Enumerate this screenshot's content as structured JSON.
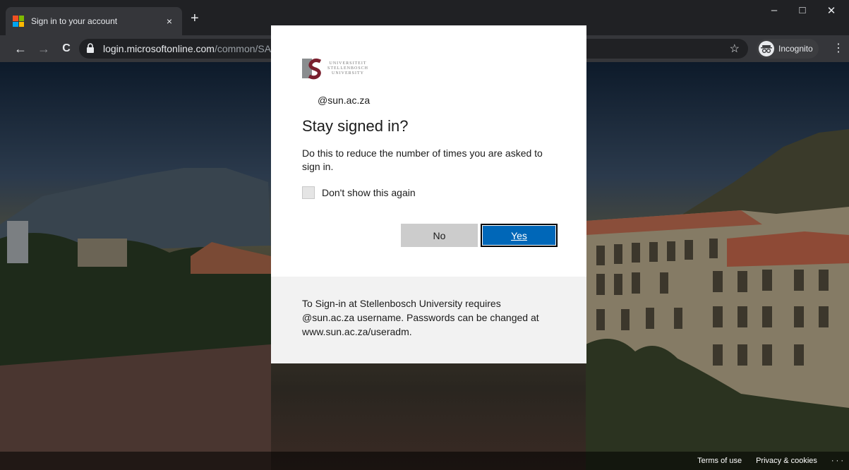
{
  "browser": {
    "tab_title": "Sign in to your account",
    "tab_close": "×",
    "new_tab": "+",
    "window_controls": {
      "minimize": "–",
      "maximize": "□",
      "close": "✕"
    },
    "nav": {
      "back": "←",
      "forward": "→",
      "reload": "C"
    },
    "url_host": "login.microsoftonline.com",
    "url_path": "/common/SAS/ProcessAuth",
    "bookmark_icon": "☆",
    "incognito_label": "Incognito",
    "menu_icon": "⋮"
  },
  "dialog": {
    "logo_lines": [
      "UNIVERSITEIT",
      "STELLENBOSCH",
      "UNIVERSITY"
    ],
    "identity": "@sun.ac.za",
    "heading": "Stay signed in?",
    "description": "Do this to reduce the number of times you are asked to sign in.",
    "checkbox_label": "Don't show this again",
    "no_label": "No",
    "yes_label": "Yes",
    "info_text": "To Sign-in at Stellenbosch University requires @sun.ac.za username. Passwords can be changed at www.sun.ac.za/useradm."
  },
  "footer": {
    "terms": "Terms of use",
    "privacy": "Privacy & cookies",
    "more": "· · ·"
  },
  "colors": {
    "primary_button": "#0067b8",
    "secondary_button": "#cccccc",
    "info_panel": "#f2f2f2"
  }
}
